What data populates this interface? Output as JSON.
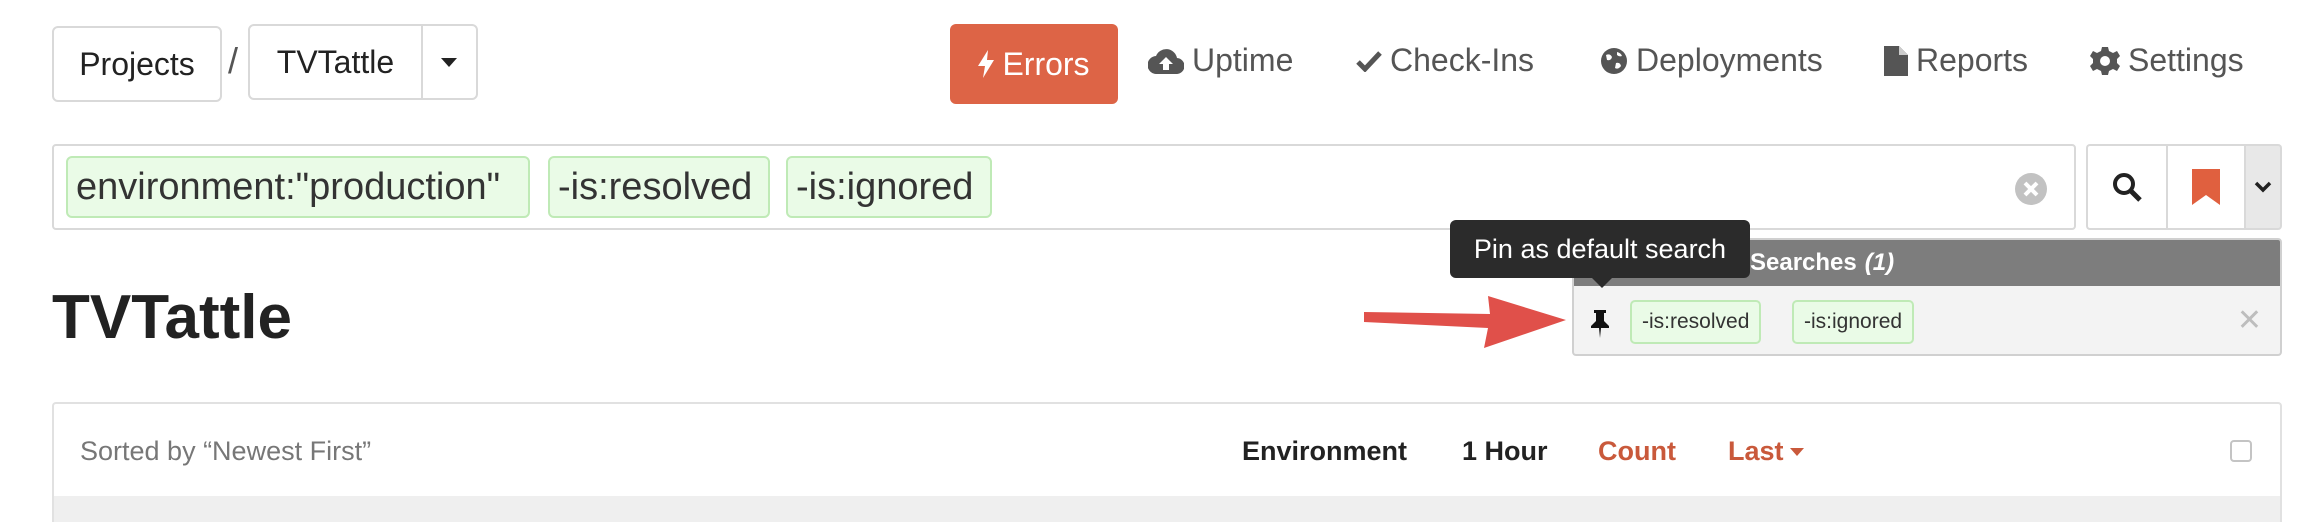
{
  "breadcrumb": {
    "projects_label": "Projects",
    "separator": "/",
    "project_name": "TVTattle"
  },
  "nav": {
    "errors": "Errors",
    "uptime": "Uptime",
    "checkins": "Check-Ins",
    "deployments": "Deployments",
    "reports": "Reports",
    "settings": "Settings",
    "active": "errors",
    "accent_color": "#dd6446"
  },
  "search": {
    "tokens": [
      "environment:\"production\"",
      "-is:resolved",
      "-is:ignored"
    ]
  },
  "page_title": "TVTattle",
  "saved_searches": {
    "header": "Searches",
    "count": "(1)",
    "items": [
      {
        "tokens": [
          "-is:resolved",
          "-is:ignored"
        ]
      }
    ]
  },
  "tooltip": "Pin as default search",
  "list": {
    "sort_label": "Sorted by “Newest First”",
    "columns": {
      "environment": "Environment",
      "hour": "1 Hour",
      "count": "Count",
      "last": "Last"
    }
  }
}
